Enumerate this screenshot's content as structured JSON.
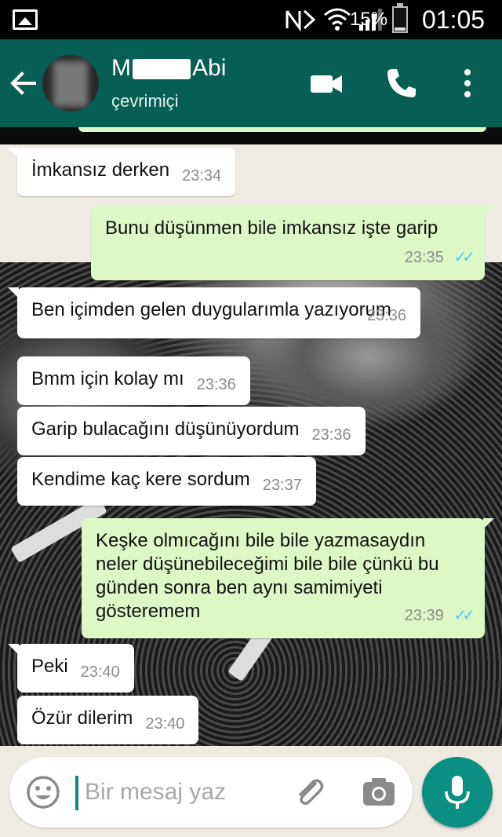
{
  "status_bar": {
    "battery_percent": "15%",
    "battery_level": 0.15,
    "time": "01:05",
    "icons": [
      "gallery-icon",
      "nfc-icon",
      "wifi-icon",
      "signal-icon",
      "battery-icon"
    ]
  },
  "header": {
    "name_visible_start": "M",
    "name_visible_end": "Abi",
    "status": "çevrimiçi",
    "background_color": "#075e54",
    "icons": [
      "back-arrow-icon",
      "video-call-icon",
      "phone-icon",
      "more-vert-icon"
    ]
  },
  "messages": [
    {
      "direction": "in",
      "text": "İmkansız derken",
      "time": "23:34"
    },
    {
      "direction": "out",
      "text": "Bunu düşünmen bile imkansız işte garip",
      "time": "23:35",
      "read": true
    },
    {
      "direction": "in",
      "text": "Ben içimden gelen duygularımla yazıyorum",
      "time": "23:36"
    },
    {
      "direction": "in",
      "text": "Bmm için kolay mı",
      "time": "23:36"
    },
    {
      "direction": "in",
      "text": "Garip bulacağını düşünüyordum",
      "time": "23:36"
    },
    {
      "direction": "in",
      "text": "Kendime kaç kere sordum",
      "time": "23:37"
    },
    {
      "direction": "out",
      "text": "Keşke olmıcağını bile bile yazmasaydın neler düşünebileceğimi bile bile çünkü bu günden sonra ben aynı samimiyeti gösteremem",
      "time": "23:39",
      "read": true
    },
    {
      "direction": "in",
      "text": "Peki",
      "time": "23:40"
    },
    {
      "direction": "in",
      "text": "Özür dilerim",
      "time": "23:40"
    }
  ],
  "colors": {
    "incoming_bubble": "#ffffff",
    "outgoing_bubble": "#dcf8c6",
    "read_ticks": "#4fc3f7",
    "accent": "#0b8f82"
  },
  "input": {
    "placeholder": "Bir mesaj yaz",
    "icons": [
      "emoji-icon",
      "attach-icon",
      "camera-icon",
      "mic-icon"
    ]
  }
}
